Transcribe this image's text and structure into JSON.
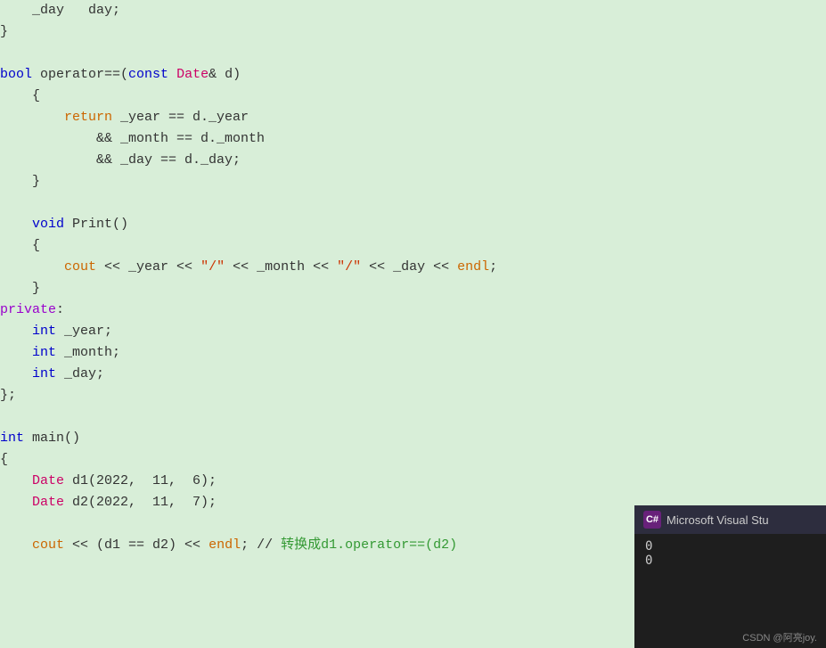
{
  "code": {
    "bg": "#d8eed8",
    "lines": [
      {
        "gutter": "",
        "tokens": [
          {
            "t": "    _day",
            "c": "var"
          },
          {
            "t": "   ",
            "c": "normal"
          },
          {
            "t": "day",
            "c": "var"
          },
          {
            "t": ";",
            "c": "punct"
          }
        ]
      },
      {
        "gutter": "",
        "tokens": [
          {
            "t": "}",
            "c": "punct"
          }
        ]
      },
      {
        "gutter": "",
        "tokens": []
      },
      {
        "gutter": "",
        "tokens": [
          {
            "t": "bool",
            "c": "kw-bool"
          },
          {
            "t": " operator==(",
            "c": "normal"
          },
          {
            "t": "const",
            "c": "kw-int"
          },
          {
            "t": " ",
            "c": "normal"
          },
          {
            "t": "Date",
            "c": "type-date"
          },
          {
            "t": "& d)",
            "c": "normal"
          }
        ]
      },
      {
        "gutter": "",
        "tokens": [
          {
            "t": "    {",
            "c": "punct"
          }
        ]
      },
      {
        "gutter": "",
        "tokens": [
          {
            "t": "        ",
            "c": "normal"
          },
          {
            "t": "return",
            "c": "kw-return"
          },
          {
            "t": " _year == d._year",
            "c": "normal"
          }
        ]
      },
      {
        "gutter": "",
        "tokens": [
          {
            "t": "            && _month == d._month",
            "c": "normal"
          }
        ]
      },
      {
        "gutter": "",
        "tokens": [
          {
            "t": "            && _day == d._day;",
            "c": "normal"
          }
        ]
      },
      {
        "gutter": "",
        "tokens": [
          {
            "t": "    }",
            "c": "punct"
          }
        ]
      },
      {
        "gutter": "",
        "tokens": []
      },
      {
        "gutter": "",
        "tokens": [
          {
            "t": "    ",
            "c": "normal"
          },
          {
            "t": "void",
            "c": "kw-void"
          },
          {
            "t": " Print()",
            "c": "normal"
          }
        ]
      },
      {
        "gutter": "",
        "tokens": [
          {
            "t": "    {",
            "c": "punct"
          }
        ]
      },
      {
        "gutter": "",
        "tokens": [
          {
            "t": "        ",
            "c": "normal"
          },
          {
            "t": "cout",
            "c": "kw-cout"
          },
          {
            "t": " << _year << ",
            "c": "normal"
          },
          {
            "t": "\"/\"",
            "c": "str"
          },
          {
            "t": " << _month << ",
            "c": "normal"
          },
          {
            "t": "\"/\"",
            "c": "str"
          },
          {
            "t": " << _day << ",
            "c": "normal"
          },
          {
            "t": "endl",
            "c": "kw-cout"
          },
          {
            "t": ";",
            "c": "punct"
          }
        ]
      },
      {
        "gutter": "",
        "tokens": [
          {
            "t": "    }",
            "c": "punct"
          }
        ]
      },
      {
        "gutter": "",
        "tokens": [
          {
            "t": "private",
            "c": "kw-private"
          },
          {
            "t": ":",
            "c": "punct"
          }
        ]
      },
      {
        "gutter": "",
        "tokens": [
          {
            "t": "    ",
            "c": "normal"
          },
          {
            "t": "int",
            "c": "kw-int"
          },
          {
            "t": " _year;",
            "c": "normal"
          }
        ]
      },
      {
        "gutter": "",
        "tokens": [
          {
            "t": "    ",
            "c": "normal"
          },
          {
            "t": "int",
            "c": "kw-int"
          },
          {
            "t": " _month;",
            "c": "normal"
          }
        ]
      },
      {
        "gutter": "",
        "tokens": [
          {
            "t": "    ",
            "c": "normal"
          },
          {
            "t": "int",
            "c": "kw-int"
          },
          {
            "t": " _day;",
            "c": "normal"
          }
        ]
      },
      {
        "gutter": "",
        "tokens": [
          {
            "t": "};",
            "c": "punct"
          }
        ]
      },
      {
        "gutter": "",
        "tokens": []
      },
      {
        "gutter": "",
        "tokens": [
          {
            "t": "int",
            "c": "kw-int"
          },
          {
            "t": " main()",
            "c": "normal"
          }
        ]
      },
      {
        "gutter": "",
        "tokens": [
          {
            "t": "{",
            "c": "punct"
          }
        ]
      },
      {
        "gutter": "",
        "tokens": [
          {
            "t": "    ",
            "c": "normal"
          },
          {
            "t": "Date",
            "c": "type-date"
          },
          {
            "t": " d1(2022,  11,  6);",
            "c": "normal"
          }
        ]
      },
      {
        "gutter": "",
        "tokens": [
          {
            "t": "    ",
            "c": "normal"
          },
          {
            "t": "Date",
            "c": "type-date"
          },
          {
            "t": " d2(2022,  11,  7);",
            "c": "normal"
          }
        ]
      },
      {
        "gutter": "",
        "tokens": []
      },
      {
        "gutter": "",
        "tokens": [
          {
            "t": "    ",
            "c": "normal"
          },
          {
            "t": "cout",
            "c": "kw-cout"
          },
          {
            "t": " << (d1 == d2) << ",
            "c": "normal"
          },
          {
            "t": "endl",
            "c": "kw-cout"
          },
          {
            "t": "; // ",
            "c": "normal"
          },
          {
            "t": "转换成d1.operator==(d2)",
            "c": "comment"
          }
        ]
      }
    ]
  },
  "side_panel": {
    "title": "Microsoft Visual Stu",
    "icon_label": "C#",
    "output_lines": [
      "0",
      "0"
    ],
    "footer": "CSDN @阿亮joy."
  }
}
